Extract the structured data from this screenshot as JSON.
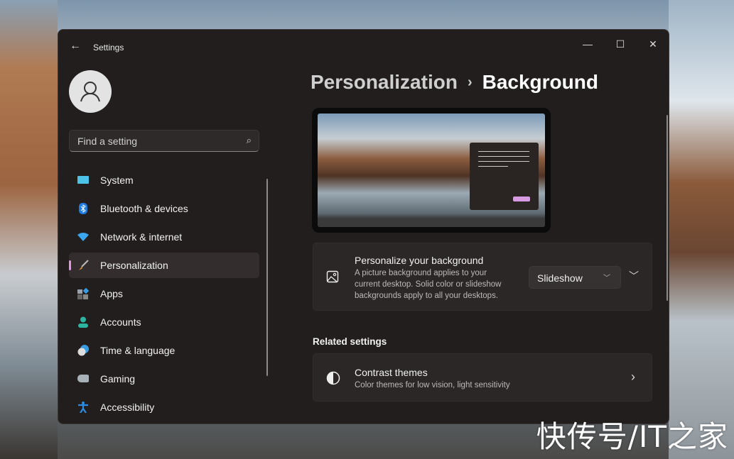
{
  "window": {
    "title": "Settings",
    "back_icon": "arrow-left-icon",
    "controls": [
      "minimize",
      "maximize",
      "close"
    ]
  },
  "search": {
    "placeholder": "Find a setting",
    "icon": "search-icon"
  },
  "sidebar": {
    "items": [
      {
        "label": "System",
        "icon": "monitor-icon",
        "color": "#4cc2e6"
      },
      {
        "label": "Bluetooth & devices",
        "icon": "bluetooth-icon",
        "color": "#1e7be0"
      },
      {
        "label": "Network & internet",
        "icon": "wifi-icon",
        "color": "#3aa7f0"
      },
      {
        "label": "Personalization",
        "icon": "paintbrush-icon",
        "color": "#f0a040",
        "active": true
      },
      {
        "label": "Apps",
        "icon": "apps-icon",
        "color": "#9aa3ad"
      },
      {
        "label": "Accounts",
        "icon": "person-icon",
        "color": "#2bb5a0"
      },
      {
        "label": "Time & language",
        "icon": "clock-globe-icon",
        "color": "#3a9be0"
      },
      {
        "label": "Gaming",
        "icon": "gamepad-icon",
        "color": "#a8b0b8"
      },
      {
        "label": "Accessibility",
        "icon": "accessibility-icon",
        "color": "#2a8ee8"
      }
    ]
  },
  "breadcrumb": {
    "parent": "Personalization",
    "current": "Background"
  },
  "background_card": {
    "title": "Personalize your background",
    "description": "A picture background applies to your current desktop. Solid color or slideshow backgrounds apply to all your desktops.",
    "selected": "Slideshow",
    "icon": "image-icon"
  },
  "related": {
    "heading": "Related settings",
    "items": [
      {
        "title": "Contrast themes",
        "description": "Color themes for low vision, light sensitivity",
        "icon": "contrast-icon"
      }
    ]
  },
  "accent_color": "#d69be0",
  "watermark": "快传号/IT之家"
}
